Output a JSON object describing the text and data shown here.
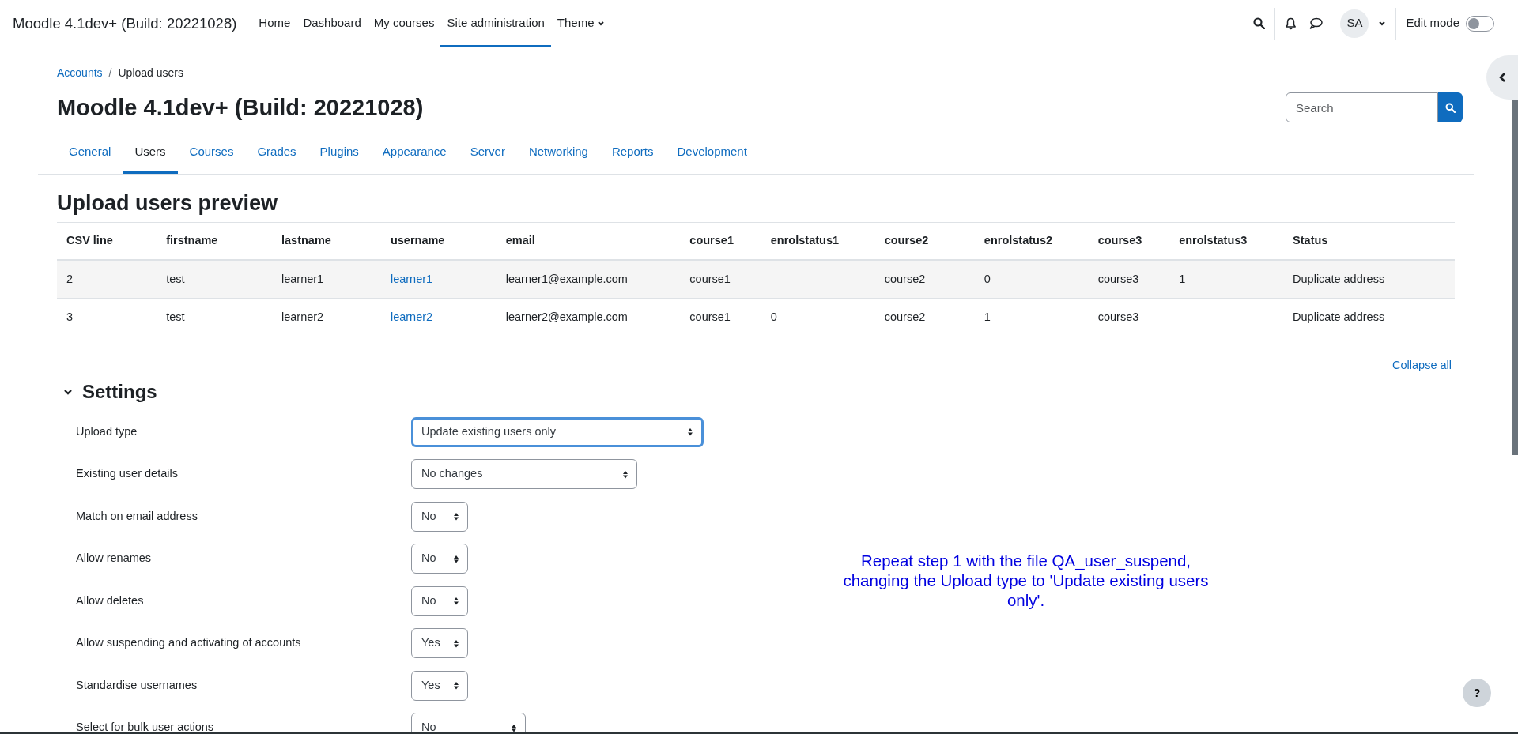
{
  "navbar": {
    "site_name": "Moodle 4.1dev+ (Build: 20221028)",
    "items": [
      {
        "label": "Home",
        "selected": false,
        "dropdown": false
      },
      {
        "label": "Dashboard",
        "selected": false,
        "dropdown": false
      },
      {
        "label": "My courses",
        "selected": false,
        "dropdown": false
      },
      {
        "label": "Site administration",
        "selected": true,
        "dropdown": false
      },
      {
        "label": "Theme",
        "selected": false,
        "dropdown": true
      }
    ],
    "avatar": "SA",
    "edit_mode": {
      "label": "Edit mode",
      "on": false
    }
  },
  "breadcrumb_separator": "/",
  "breadcrumb": [
    {
      "label": "Accounts",
      "link": true
    },
    {
      "label": "Upload users",
      "link": false
    }
  ],
  "page_title": "Moodle 4.1dev+ (Build: 20221028)",
  "search": {
    "placeholder": "Search"
  },
  "tabs": [
    {
      "label": "General",
      "selected": false
    },
    {
      "label": "Users",
      "selected": true
    },
    {
      "label": "Courses",
      "selected": false
    },
    {
      "label": "Grades",
      "selected": false
    },
    {
      "label": "Plugins",
      "selected": false
    },
    {
      "label": "Appearance",
      "selected": false
    },
    {
      "label": "Server",
      "selected": false
    },
    {
      "label": "Networking",
      "selected": false
    },
    {
      "label": "Reports",
      "selected": false
    },
    {
      "label": "Development",
      "selected": false
    }
  ],
  "preview": {
    "heading": "Upload users preview",
    "columns": [
      "CSV line",
      "firstname",
      "lastname",
      "username",
      "email",
      "course1",
      "enrolstatus1",
      "course2",
      "enrolstatus2",
      "course3",
      "enrolstatus3",
      "Status"
    ],
    "rows": [
      {
        "cells": [
          "2",
          "test",
          "learner1",
          "learner1",
          "learner1@example.com",
          "course1",
          "",
          "course2",
          "0",
          "course3",
          "1",
          "Duplicate address"
        ]
      },
      {
        "cells": [
          "3",
          "test",
          "learner2",
          "learner2",
          "learner2@example.com",
          "course1",
          "0",
          "course2",
          "1",
          "course3",
          "",
          "Duplicate address"
        ]
      }
    ]
  },
  "collapse_all": "Collapse all",
  "settings": {
    "heading": "Settings",
    "expanded": true,
    "fields": [
      {
        "label": "Upload type",
        "value": "Update existing users only",
        "focused": true
      },
      {
        "label": "Existing user details",
        "value": "No changes",
        "focused": false
      },
      {
        "label": "Match on email address",
        "value": "No",
        "focused": false
      },
      {
        "label": "Allow renames",
        "value": "No",
        "focused": false
      },
      {
        "label": "Allow deletes",
        "value": "No",
        "focused": false
      },
      {
        "label": "Allow suspending and activating of accounts",
        "value": "Yes",
        "focused": false
      },
      {
        "label": "Standardise usernames",
        "value": "Yes",
        "focused": false
      },
      {
        "label": "Select for bulk user actions",
        "value": "No",
        "focused": false
      }
    ]
  },
  "annotation": "Repeat step 1 with the file QA_user_suspend, changing the Upload type to 'Update existing users only'.",
  "help_button": "?"
}
